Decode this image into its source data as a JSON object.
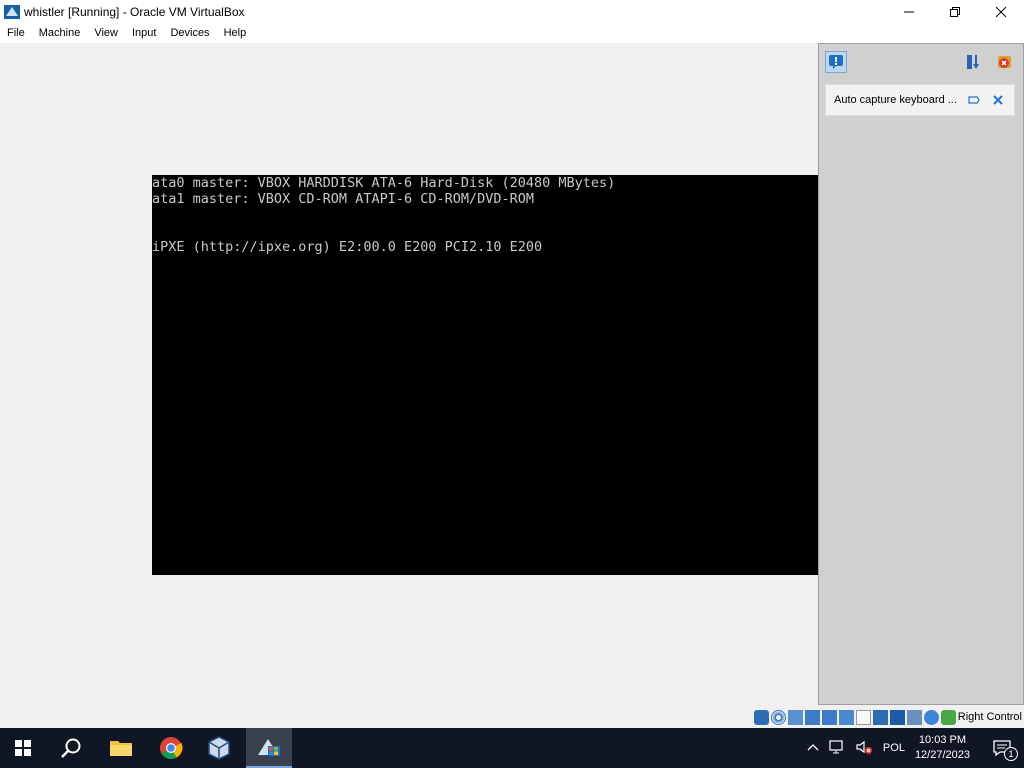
{
  "window": {
    "title": "whistler [Running] - Oracle VM VirtualBox"
  },
  "menu": [
    "File",
    "Machine",
    "View",
    "Input",
    "Devices",
    "Help"
  ],
  "vm_console": {
    "lines": [
      "ata0 master: VBOX HARDDISK ATA-6 Hard-Disk (20480 MBytes)",
      "ata1 master: VBOX CD-ROM ATAPI-6 CD-ROM/DVD-ROM",
      "",
      "",
      "iPXE (http://ipxe.org) E2:00.0 E200 PCI2.10 E200"
    ]
  },
  "notification": {
    "text": "Auto capture keyboard ..."
  },
  "statusbar": {
    "host_key": "Right Control"
  },
  "taskbar": {
    "tray": {
      "language": "POL",
      "time": "10:03 PM",
      "date": "12/27/2023",
      "notification_count": "1"
    }
  },
  "colors": {
    "taskbar_bg": "#101624",
    "console_text": "#c8c8c8",
    "panel_bg": "#d0d0d0"
  }
}
